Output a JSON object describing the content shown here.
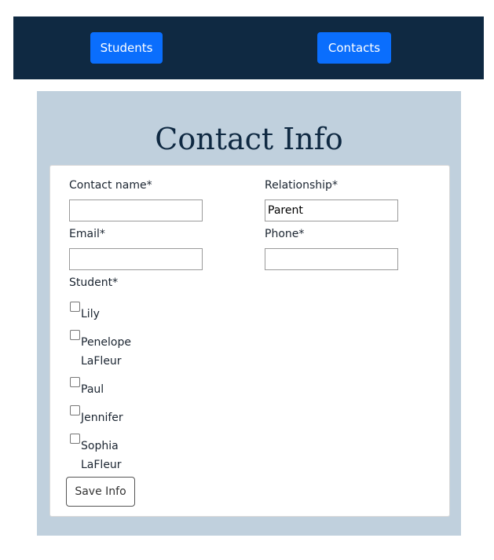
{
  "nav": {
    "students_label": "Students",
    "contacts_label": "Contacts"
  },
  "form": {
    "title": "Contact Info",
    "contact_name_label": "Contact name*",
    "contact_name_value": "",
    "relationship_label": "Relationship*",
    "relationship_value": "Parent",
    "email_label": "Email*",
    "email_value": "",
    "phone_label": "Phone*",
    "phone_value": "",
    "student_label": "Student*",
    "students": [
      {
        "name": "Lily",
        "checked": false
      },
      {
        "name": "Penelope LaFleur",
        "checked": false
      },
      {
        "name": "Paul",
        "checked": false
      },
      {
        "name": "Jennifer",
        "checked": false
      },
      {
        "name": "Sophia LaFleur",
        "checked": false
      }
    ],
    "save_label": "Save Info"
  },
  "colors": {
    "navbar_bg": "#0f2942",
    "primary_button": "#0a6efd",
    "panel_bg": "#c0d0dd"
  }
}
